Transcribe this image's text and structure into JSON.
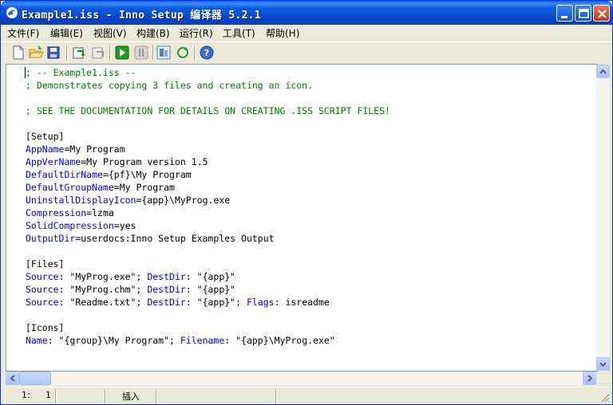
{
  "window": {
    "title": "Example1.iss - Inno Setup 编译器 5.2.1"
  },
  "menu": [
    {
      "label": "文件(F)"
    },
    {
      "label": "编辑(E)"
    },
    {
      "label": "视图(V)"
    },
    {
      "label": "构建(B)"
    },
    {
      "label": "运行(R)"
    },
    {
      "label": "工具(T)"
    },
    {
      "label": "帮助(H)"
    }
  ],
  "toolbar": {
    "icons": [
      "new-file-icon",
      "open-folder-icon",
      "save-icon",
      "compile-icon",
      "stop-compile-icon",
      "run-icon",
      "pause-icon",
      "target-icon",
      "refresh-icon",
      "help-icon"
    ]
  },
  "editor": {
    "lines": [
      {
        "parts": [
          {
            "t": "; -- Example1.iss --",
            "c": "comment"
          }
        ]
      },
      {
        "parts": [
          {
            "t": "; Demonstrates copying 3 files and creating an icon.",
            "c": "comment"
          }
        ]
      },
      {
        "parts": [
          {
            "t": "",
            "c": "text"
          }
        ]
      },
      {
        "parts": [
          {
            "t": "; SEE THE DOCUMENTATION FOR DETAILS ON CREATING .ISS SCRIPT FILES!",
            "c": "comment"
          }
        ]
      },
      {
        "parts": [
          {
            "t": "",
            "c": "text"
          }
        ]
      },
      {
        "parts": [
          {
            "t": "[Setup]",
            "c": "section"
          }
        ]
      },
      {
        "parts": [
          {
            "t": "AppName",
            "c": "key"
          },
          {
            "t": "=My Program",
            "c": "text"
          }
        ]
      },
      {
        "parts": [
          {
            "t": "AppVerName",
            "c": "key"
          },
          {
            "t": "=My Program version 1.5",
            "c": "text"
          }
        ]
      },
      {
        "parts": [
          {
            "t": "DefaultDirName",
            "c": "key"
          },
          {
            "t": "={pf}\\My Program",
            "c": "text"
          }
        ]
      },
      {
        "parts": [
          {
            "t": "DefaultGroupName",
            "c": "key"
          },
          {
            "t": "=My Program",
            "c": "text"
          }
        ]
      },
      {
        "parts": [
          {
            "t": "UninstallDisplayIcon",
            "c": "key"
          },
          {
            "t": "={app}\\MyProg.exe",
            "c": "text"
          }
        ]
      },
      {
        "parts": [
          {
            "t": "Compression",
            "c": "key"
          },
          {
            "t": "=lzma",
            "c": "text"
          }
        ]
      },
      {
        "parts": [
          {
            "t": "SolidCompression",
            "c": "key"
          },
          {
            "t": "=yes",
            "c": "text"
          }
        ]
      },
      {
        "parts": [
          {
            "t": "OutputDir",
            "c": "key"
          },
          {
            "t": "=userdocs:Inno Setup Examples Output",
            "c": "text"
          }
        ]
      },
      {
        "parts": [
          {
            "t": "",
            "c": "text"
          }
        ]
      },
      {
        "parts": [
          {
            "t": "[Files]",
            "c": "section"
          }
        ]
      },
      {
        "parts": [
          {
            "t": "Source",
            "c": "key"
          },
          {
            "t": ": \"MyProg.exe\"; ",
            "c": "text"
          },
          {
            "t": "DestDir",
            "c": "key"
          },
          {
            "t": ": \"{app}\"",
            "c": "text"
          }
        ]
      },
      {
        "parts": [
          {
            "t": "Source",
            "c": "key"
          },
          {
            "t": ": \"MyProg.chm\"; ",
            "c": "text"
          },
          {
            "t": "DestDir",
            "c": "key"
          },
          {
            "t": ": \"{app}\"",
            "c": "text"
          }
        ]
      },
      {
        "parts": [
          {
            "t": "Source",
            "c": "key"
          },
          {
            "t": ": \"Readme.txt\"; ",
            "c": "text"
          },
          {
            "t": "DestDir",
            "c": "key"
          },
          {
            "t": ": \"{app}\"; ",
            "c": "text"
          },
          {
            "t": "Flags",
            "c": "key"
          },
          {
            "t": ": isreadme",
            "c": "text"
          }
        ]
      },
      {
        "parts": [
          {
            "t": "",
            "c": "text"
          }
        ]
      },
      {
        "parts": [
          {
            "t": "[Icons]",
            "c": "section"
          }
        ]
      },
      {
        "parts": [
          {
            "t": "Name",
            "c": "key"
          },
          {
            "t": ": \"{group}\\My Program\"; ",
            "c": "text"
          },
          {
            "t": "Filename",
            "c": "key"
          },
          {
            "t": ": \"{app}\\MyProg.exe\"",
            "c": "text"
          }
        ]
      }
    ]
  },
  "status": {
    "line": "1:",
    "col": "1",
    "mode": "插入"
  },
  "colors": {
    "comment": "#008000",
    "key": "#0000FF",
    "text": "#000000",
    "titlebar": "#0A5FEA"
  }
}
